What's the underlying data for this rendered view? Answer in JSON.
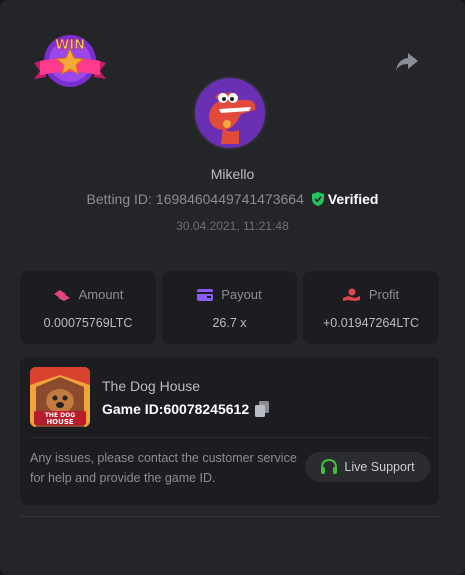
{
  "header": {
    "badge_text": "WIN",
    "badge_icon": "win-badge-icon",
    "share_icon": "share-icon"
  },
  "user": {
    "avatar_icon": "crocodile-avatar",
    "name": "Mikello",
    "betting_label": "Betting ID:",
    "betting_id": "1698460449741473664",
    "verified_label": "Verified",
    "timestamp": "30.04.2021, 11:21:48"
  },
  "stats": {
    "amount": {
      "label": "Amount",
      "value": "0.00075769LTC",
      "icon": "bet-chip-icon",
      "color": "#e0457b"
    },
    "payout": {
      "label": "Payout",
      "value": "26.7 x",
      "icon": "wallet-card-icon",
      "color": "#8b5cf6"
    },
    "profit": {
      "label": "Profit",
      "value": "+0.01947264LTC",
      "icon": "hand-coin-icon",
      "color": "#e0454f"
    }
  },
  "game": {
    "name": "The Dog House",
    "id_label": "Game ID:",
    "id_value": "60078245612",
    "thumb_text_1": "THE DOG",
    "thumb_text_2": "HOUSE",
    "contact_text": "Any issues, please contact the customer service for help and provide the game ID.",
    "live_support_label": "Live Support",
    "live_support_icon": "headset-icon",
    "accent": "#3fbf3f"
  },
  "colors": {
    "background": "#242529",
    "card": "#1c1d20",
    "verified": "#22c55e"
  }
}
